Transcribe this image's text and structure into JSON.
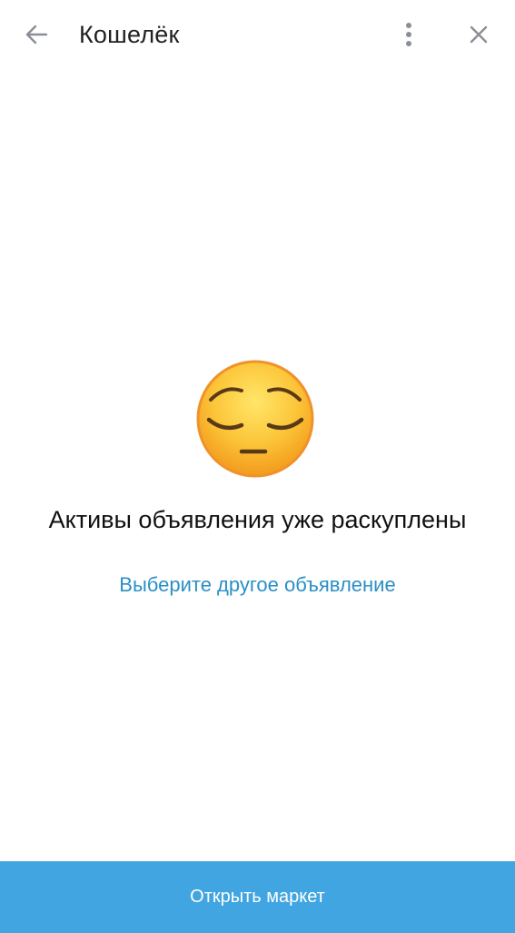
{
  "header": {
    "title": "Кошелёк",
    "back_icon": "arrow-left-icon",
    "menu_icon": "more-vertical-icon",
    "close_icon": "close-icon"
  },
  "main": {
    "emoji": "pensive-face",
    "message": "Активы объявления уже раскуплены",
    "link_label": "Выберите другое объявление"
  },
  "footer": {
    "button_label": "Открыть маркет"
  },
  "colors": {
    "accent": "#40a5e0",
    "link": "#2b8fc6",
    "icon": "#8a8f96",
    "text": "#111111"
  }
}
